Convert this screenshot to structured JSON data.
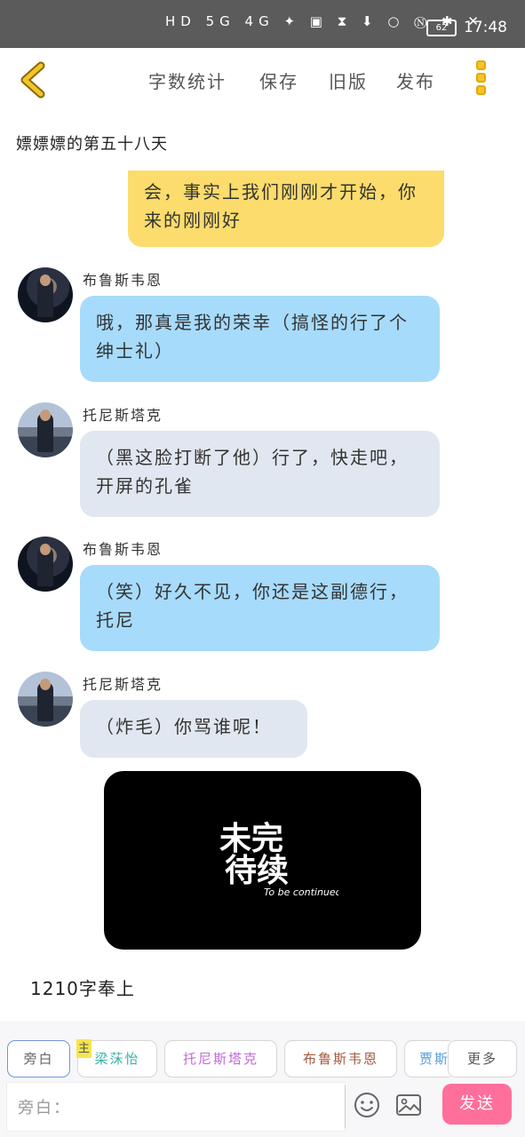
{
  "status_bar": {
    "indicators": "HD 5G 4G ✦ ▣ ⧗ ⬇ ○ Ⓝ ✱ ✕",
    "battery": "62",
    "time": "17:48"
  },
  "toolbar": {
    "word_count": "字数统计",
    "save": "保存",
    "old_version": "旧版",
    "publish": "发布"
  },
  "chapter_title": "嫖嫖嫖的第五十八天",
  "top_fragment": "会，事实上我们刚刚才开始，你来的刚刚好",
  "messages": [
    {
      "speaker": "布鲁斯韦恩",
      "text": "哦，那真是我的荣幸（搞怪的行了个绅士礼）"
    },
    {
      "speaker": "托尼斯塔克",
      "text": "（黑这脸打断了他）行了，快走吧，开屏的孔雀"
    },
    {
      "speaker": "布鲁斯韦恩",
      "text": "（笑）好久不见，你还是这副德行，托尼"
    },
    {
      "speaker": "托尼斯塔克",
      "text": "（炸毛）你骂谁呢！"
    }
  ],
  "media": {
    "title_line1": "未完",
    "title_line2": "待续",
    "subtitle": "To be continued"
  },
  "word_count_note": "1210字奉上",
  "roles": {
    "narration": "旁白",
    "main_tag": "主",
    "liang": "梁莯怡",
    "tony": "托尼斯塔克",
    "bruce": "布鲁斯韦恩",
    "partial": "贾斯",
    "more": "更多"
  },
  "input": {
    "placeholder": "旁白："
  },
  "send_label": "发送",
  "colors": {
    "yellow_bubble": "#fbdc6c",
    "blue_bubble": "#a7dbfb",
    "grey_bubble": "#e1e7f0",
    "send_button": "#ff6f9c",
    "accent": "#f4c42c"
  }
}
